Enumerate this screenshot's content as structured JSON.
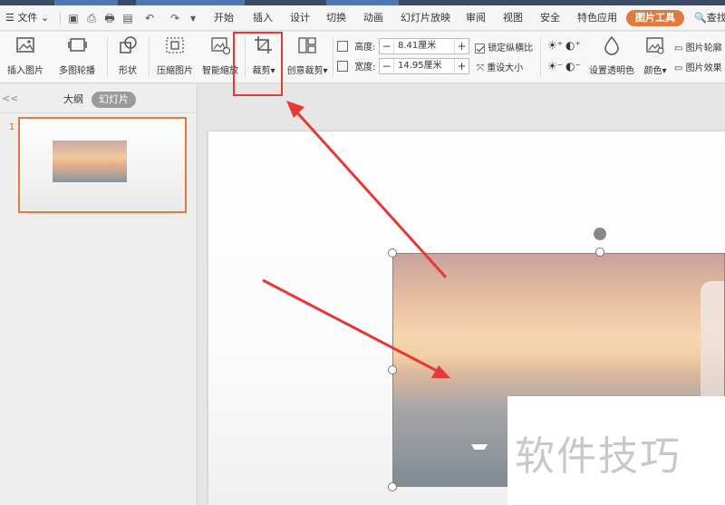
{
  "menu": {
    "file": "文件",
    "tabs": [
      "开始",
      "插入",
      "设计",
      "切换",
      "动画",
      "幻灯片放映",
      "审阅",
      "视图",
      "安全",
      "特色应用"
    ],
    "active_tab": "图片工具",
    "search": "查找"
  },
  "ribbon": {
    "insert_picture": "插入图片",
    "multi_outline": "多图轮播",
    "shape": "形状",
    "compress": "压缩图片",
    "smart_scale": "智能缩放",
    "crop": "裁剪",
    "creative_crop": "创意裁剪",
    "height_label": "高度:",
    "height_value": "8.41厘米",
    "width_label": "宽度:",
    "width_value": "14.95厘米",
    "lock_ratio": "锁定纵横比",
    "reset_size": "重设大小",
    "set_transparent": "设置透明色",
    "color": "颜色",
    "picture_outline": "图片轮廓",
    "picture_effect": "图片效果"
  },
  "left_panel": {
    "tab_outline": "大纲",
    "tab_slides": "幻灯片",
    "collapse": "<<",
    "slide_number": "1"
  },
  "watermark": "软件技巧",
  "colors": {
    "accent": "#e07a3d",
    "annotation": "#e53935"
  }
}
